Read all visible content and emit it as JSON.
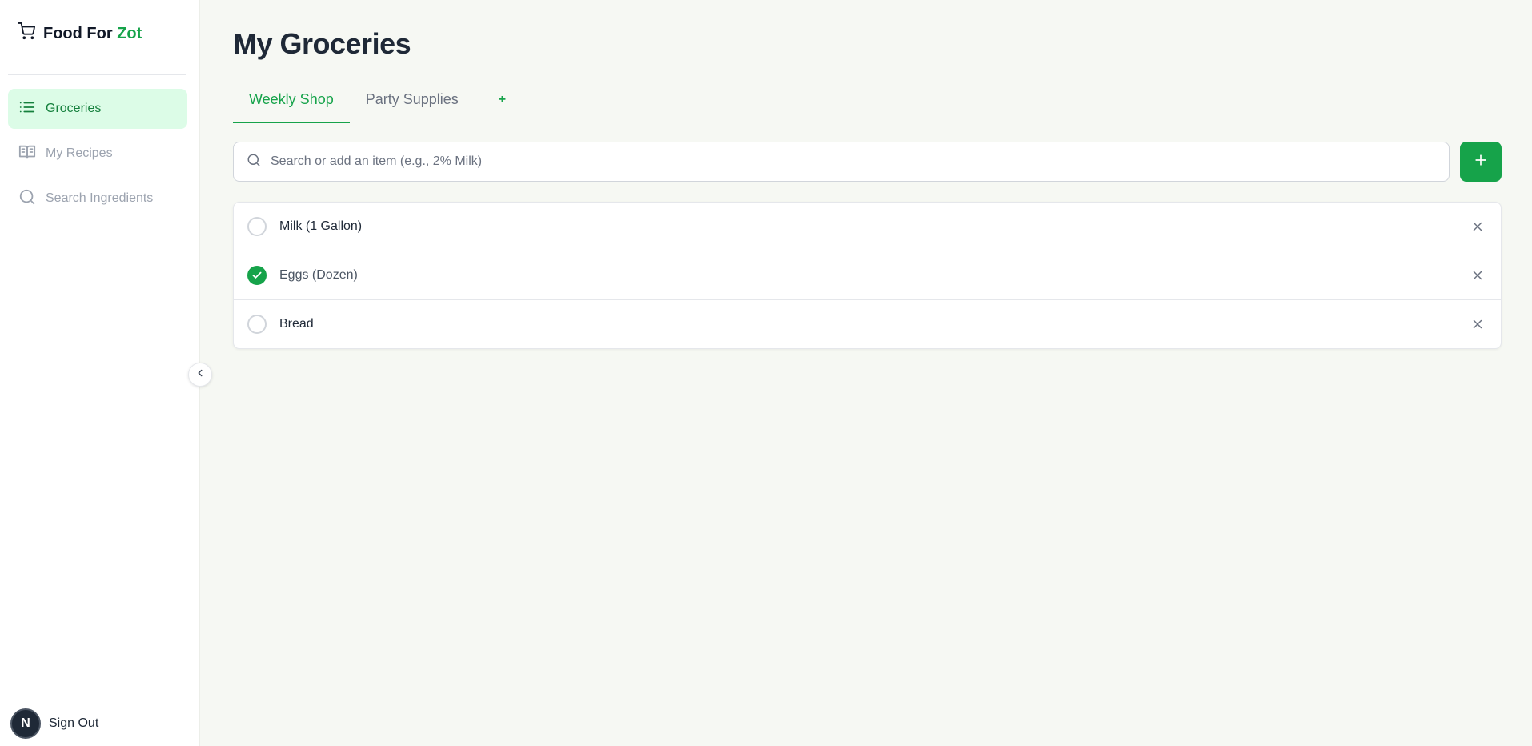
{
  "app": {
    "brand_main": "Food For",
    "brand_accent": "Zot"
  },
  "sidebar": {
    "items": [
      {
        "label": "Groceries",
        "icon": "list-icon",
        "active": true
      },
      {
        "label": "My Recipes",
        "icon": "book-icon",
        "active": false
      },
      {
        "label": "Search Ingredients",
        "icon": "search-icon",
        "active": false
      }
    ],
    "signout_label": "Sign Out",
    "avatar_letter": "N"
  },
  "main": {
    "title": "My Groceries",
    "tabs": [
      {
        "label": "Weekly Shop",
        "active": true
      },
      {
        "label": "Party Supplies",
        "active": false
      }
    ],
    "add_tab_label": "+",
    "search": {
      "placeholder": "Search or add an item (e.g., 2% Milk)",
      "value": ""
    },
    "add_button_label": "+",
    "items": [
      {
        "label": "Milk (1 Gallon)",
        "checked": false
      },
      {
        "label": "Eggs (Dozen)",
        "checked": true
      },
      {
        "label": "Bread",
        "checked": false
      }
    ]
  },
  "colors": {
    "accent": "#16a34a",
    "active_nav_bg": "#dcfce7",
    "background": "#f6f8f3"
  }
}
